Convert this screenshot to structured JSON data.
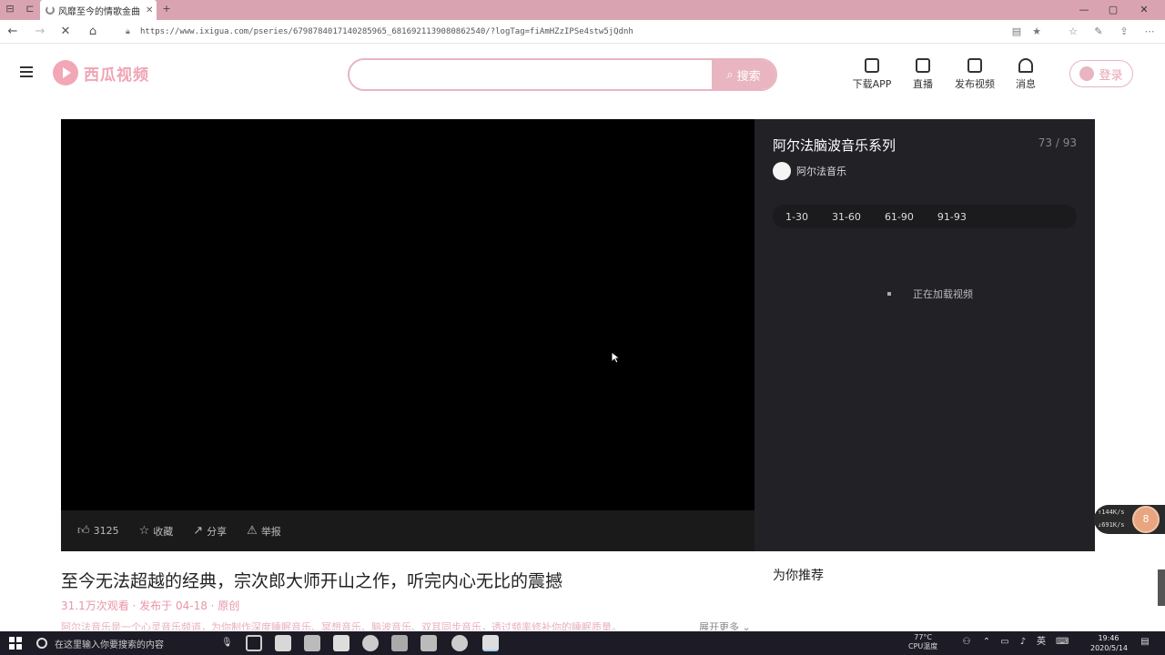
{
  "browser": {
    "tab_title": "风靡至今的情歌金曲",
    "url": "https://www.ixigua.com/pseries/6798784017140285965_6816921139080862540/?logTag=fiAmHZzIPSe4stw5jQdnh",
    "back": "←",
    "forward": "→",
    "reload": "✕",
    "home": "⌂"
  },
  "header": {
    "logo_text": "西瓜视频",
    "search_placeholder": "",
    "search_label": "搜索",
    "actions": [
      {
        "label": "下载APP"
      },
      {
        "label": "直播"
      },
      {
        "label": "发布视频"
      },
      {
        "label": "消息"
      }
    ],
    "login_label": "登录"
  },
  "video_actions": {
    "like_count": "3125",
    "collect": "收藏",
    "share": "分享",
    "report": "举报"
  },
  "playlist": {
    "title": "阿尔法脑波音乐系列",
    "count": "73 / 93",
    "author": "阿尔法音乐",
    "tabs": [
      "1-30",
      "31-60",
      "61-90",
      "91-93"
    ],
    "loading_text": "正在加载视频"
  },
  "speed_widget": {
    "up": "↑144K/s",
    "down": "↓691K/s",
    "ball": "8"
  },
  "video": {
    "title": "至今无法超越的经典，宗次郎大师开山之作，听完内心无比的震撼",
    "meta": "31.1万次观看 · 发布于 04-18 · 原创",
    "description": "阿尔法音乐是一个心灵音乐频道，为你制作深度睡眠音乐、冥想音乐、脑波音乐、双耳同步音乐，透过频率修补你的睡眠质量。",
    "expand_label": "展开更多"
  },
  "recommend_title": "为你推荐",
  "taskbar": {
    "search_placeholder": "在这里输入你要搜索的内容",
    "weather_temp": "77°C",
    "weather_label": "CPU温度",
    "time": "19:46",
    "date": "2020/5/14",
    "ime": "英"
  },
  "colors": {
    "brand_pink": "#e8b5c0",
    "tabbar": "#d9a3b2",
    "player_bg": "#000000",
    "playlist_bg": "#222226"
  }
}
